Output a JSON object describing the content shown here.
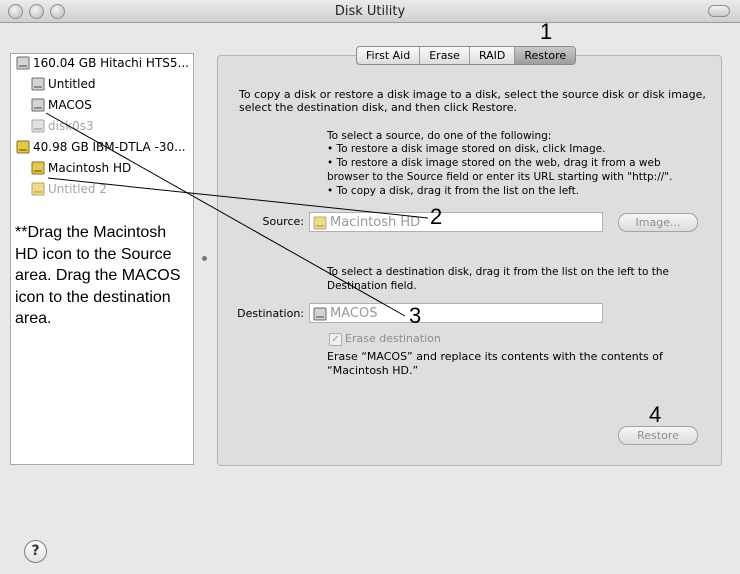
{
  "window": {
    "title": "Disk Utility"
  },
  "tabs": [
    "First Aid",
    "Erase",
    "RAID",
    "Restore"
  ],
  "sidebar": {
    "items": [
      {
        "label": "160.04 GB Hitachi HTS5...",
        "icon": "hdd-gray-icon",
        "dimmed": false
      },
      {
        "label": "Untitled",
        "icon": "volume-gray-icon",
        "dimmed": false
      },
      {
        "label": "MACOS",
        "icon": "volume-gray-icon",
        "dimmed": false
      },
      {
        "label": "disk0s3",
        "icon": "volume-gray-icon",
        "dimmed": true
      },
      {
        "label": "40.98 GB IBM-DTLA -30...",
        "icon": "hdd-yellow-icon",
        "dimmed": false
      },
      {
        "label": "Macintosh HD",
        "icon": "volume-yellow-icon",
        "dimmed": false
      },
      {
        "label": "Untitled 2",
        "icon": "volume-yellow-icon",
        "dimmed": true
      }
    ]
  },
  "instruction": "**Drag the Macintosh HD icon to the Source area.  Drag the MACOS icon to the destination area.",
  "restore": {
    "intro_lines": [
      "To copy a disk or restore a disk image to a disk, select the source disk or disk image,",
      "select the destination disk, and then click Restore."
    ],
    "source_help_lines": [
      "To select a source, do one of the following:",
      "• To restore a disk image stored on disk, click Image.",
      "• To restore a disk image stored on the web, drag it from a web",
      "   browser to the Source field or enter its URL starting with \"http://\".",
      "• To copy a disk, drag it from the list on the left."
    ],
    "source_label": "Source:",
    "source_value": "Macintosh HD",
    "image_button": "Image...",
    "dest_help_lines": [
      "To select a destination disk, drag it from the list on the left to the",
      "Destination field."
    ],
    "destination_label": "Destination:",
    "destination_value": "MACOS",
    "erase_label": "Erase destination",
    "erase_checked": true,
    "erase_note_lines": [
      "Erase “MACOS” and replace its contents with the contents of",
      "“Macintosh HD.”"
    ],
    "restore_button": "Restore"
  },
  "callouts": [
    "1",
    "2",
    "3",
    "4"
  ],
  "help_label": "?"
}
